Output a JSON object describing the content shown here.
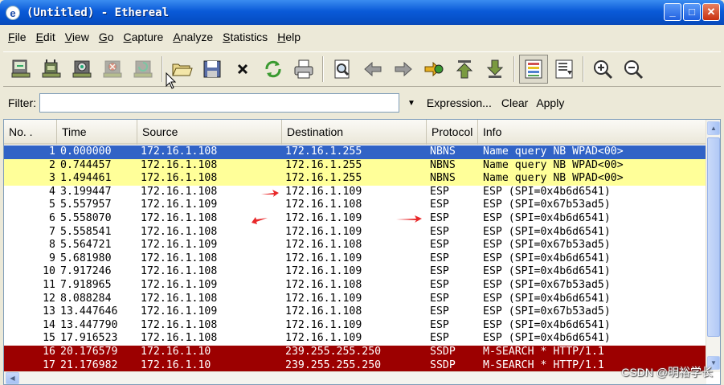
{
  "window": {
    "title": "(Untitled) - Ethereal",
    "app_icon_glyph": "e"
  },
  "window_controls": {
    "minimize": "_",
    "maximize": "□",
    "close": "✕"
  },
  "menu": [
    {
      "label_u": "F",
      "label_rest": "ile"
    },
    {
      "label_u": "E",
      "label_rest": "dit"
    },
    {
      "label_u": "V",
      "label_rest": "iew"
    },
    {
      "label_u": "G",
      "label_rest": "o"
    },
    {
      "label_u": "C",
      "label_rest": "apture"
    },
    {
      "label_u": "A",
      "label_rest": "nalyze"
    },
    {
      "label_u": "S",
      "label_rest": "tatistics"
    },
    {
      "label_u": "H",
      "label_rest": "elp"
    }
  ],
  "toolbar": {
    "icons": [
      "interfaces-icon",
      "capture-options-icon",
      "start-capture-icon",
      "stop-capture-icon",
      "restart-capture-icon",
      "open-file-icon",
      "save-file-icon",
      "close-file-icon",
      "reload-icon",
      "print-icon",
      "find-packet-icon",
      "go-back-icon",
      "go-forward-icon",
      "go-to-packet-icon",
      "go-first-icon",
      "go-last-icon",
      "colorize-icon",
      "autoscroll-icon",
      "zoom-in-icon",
      "zoom-out-icon"
    ]
  },
  "filter": {
    "label": "Filter:",
    "value": "",
    "expression_label": "Expression...",
    "clear_label": "Clear",
    "apply_label": "Apply"
  },
  "packet_list": {
    "columns": [
      "No. .",
      "Time",
      "Source",
      "Destination",
      "Protocol",
      "Info"
    ],
    "rows": [
      {
        "no": "1",
        "time": "0.000000",
        "source": "172.16.1.108",
        "destination": "172.16.1.255",
        "protocol": "NBNS",
        "info": "Name query NB WPAD<00>",
        "style": "sel"
      },
      {
        "no": "2",
        "time": "0.744457",
        "source": "172.16.1.108",
        "destination": "172.16.1.255",
        "protocol": "NBNS",
        "info": "Name query NB WPAD<00>",
        "style": "yellow"
      },
      {
        "no": "3",
        "time": "1.494461",
        "source": "172.16.1.108",
        "destination": "172.16.1.255",
        "protocol": "NBNS",
        "info": "Name query NB WPAD<00>",
        "style": "yellow"
      },
      {
        "no": "4",
        "time": "3.199447",
        "source": "172.16.1.108",
        "destination": "172.16.1.109",
        "protocol": "ESP",
        "info": "ESP (SPI=0x4b6d6541)",
        "style": ""
      },
      {
        "no": "5",
        "time": "5.557957",
        "source": "172.16.1.109",
        "destination": "172.16.1.108",
        "protocol": "ESP",
        "info": "ESP (SPI=0x67b53ad5)",
        "style": ""
      },
      {
        "no": "6",
        "time": "5.558070",
        "source": "172.16.1.108",
        "destination": "172.16.1.109",
        "protocol": "ESP",
        "info": "ESP (SPI=0x4b6d6541)",
        "style": ""
      },
      {
        "no": "7",
        "time": "5.558541",
        "source": "172.16.1.108",
        "destination": "172.16.1.109",
        "protocol": "ESP",
        "info": "ESP (SPI=0x4b6d6541)",
        "style": ""
      },
      {
        "no": "8",
        "time": "5.564721",
        "source": "172.16.1.109",
        "destination": "172.16.1.108",
        "protocol": "ESP",
        "info": "ESP (SPI=0x67b53ad5)",
        "style": ""
      },
      {
        "no": "9",
        "time": "5.681980",
        "source": "172.16.1.108",
        "destination": "172.16.1.109",
        "protocol": "ESP",
        "info": "ESP (SPI=0x4b6d6541)",
        "style": ""
      },
      {
        "no": "10",
        "time": "7.917246",
        "source": "172.16.1.108",
        "destination": "172.16.1.109",
        "protocol": "ESP",
        "info": "ESP (SPI=0x4b6d6541)",
        "style": ""
      },
      {
        "no": "11",
        "time": "7.918965",
        "source": "172.16.1.109",
        "destination": "172.16.1.108",
        "protocol": "ESP",
        "info": "ESP (SPI=0x67b53ad5)",
        "style": ""
      },
      {
        "no": "12",
        "time": "8.088284",
        "source": "172.16.1.108",
        "destination": "172.16.1.109",
        "protocol": "ESP",
        "info": "ESP (SPI=0x4b6d6541)",
        "style": ""
      },
      {
        "no": "13",
        "time": "13.447646",
        "source": "172.16.1.109",
        "destination": "172.16.1.108",
        "protocol": "ESP",
        "info": "ESP (SPI=0x67b53ad5)",
        "style": ""
      },
      {
        "no": "14",
        "time": "13.447790",
        "source": "172.16.1.108",
        "destination": "172.16.1.109",
        "protocol": "ESP",
        "info": "ESP (SPI=0x4b6d6541)",
        "style": ""
      },
      {
        "no": "15",
        "time": "17.916523",
        "source": "172.16.1.108",
        "destination": "172.16.1.109",
        "protocol": "ESP",
        "info": "ESP (SPI=0x4b6d6541)",
        "style": ""
      },
      {
        "no": "16",
        "time": "20.176579",
        "source": "172.16.1.10",
        "destination": "239.255.255.250",
        "protocol": "SSDP",
        "info": "M-SEARCH * HTTP/1.1",
        "style": "red"
      },
      {
        "no": "17",
        "time": "21.176982",
        "source": "172.16.1.10",
        "destination": "239.255.255.250",
        "protocol": "SSDP",
        "info": "M-SEARCH * HTTP/1.1",
        "style": "red"
      }
    ]
  },
  "watermark": "CSDN @明裕学长",
  "colors": {
    "selected_row": "#3163c6",
    "nbns_row": "#ffff99",
    "ssdp_row": "#9c0000",
    "annotation_arrow": "#e8282a"
  }
}
